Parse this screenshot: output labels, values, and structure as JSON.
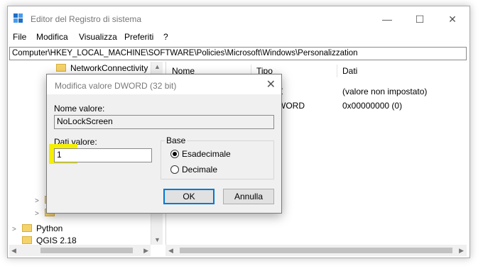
{
  "window": {
    "title": "Editor del Registro di sistema",
    "controls": {
      "minimize": "—",
      "maximize": "☐",
      "close": "✕"
    }
  },
  "menu": [
    "File",
    "Modifica",
    "Visualizza",
    "Preferiti",
    "?"
  ],
  "address": "Computer\\HKEY_LOCAL_MACHINE\\SOFTWARE\\Policies\\Microsoft\\Windows\\Personalizzation",
  "tree": {
    "items": [
      {
        "label": "NetworkConnectivity"
      },
      {
        "label": "Python"
      },
      {
        "label": "QGIS 2.18"
      }
    ]
  },
  "list": {
    "columns": [
      "Nome",
      "Tipo",
      "Dati"
    ],
    "rows": [
      {
        "tipo_visible": "Z",
        "dati": "(valore non impostato)"
      },
      {
        "tipo_visible": "WORD",
        "dati": "0x00000000 (0)"
      }
    ]
  },
  "dialog": {
    "title": "Modifica valore DWORD (32 bit)",
    "close": "✕",
    "name_label": "Nome valore:",
    "name_value": "NoLockScreen",
    "data_label": "Dati valore:",
    "data_value": "1",
    "base_label": "Base",
    "radios": [
      {
        "label": "Esadecimale",
        "selected": true
      },
      {
        "label": "Decimale",
        "selected": false
      }
    ],
    "ok": "OK",
    "cancel": "Annulla"
  },
  "colors": {
    "highlight": "#f5f000",
    "default_button_border": "#0078d7",
    "folder": "#f4d36c"
  }
}
